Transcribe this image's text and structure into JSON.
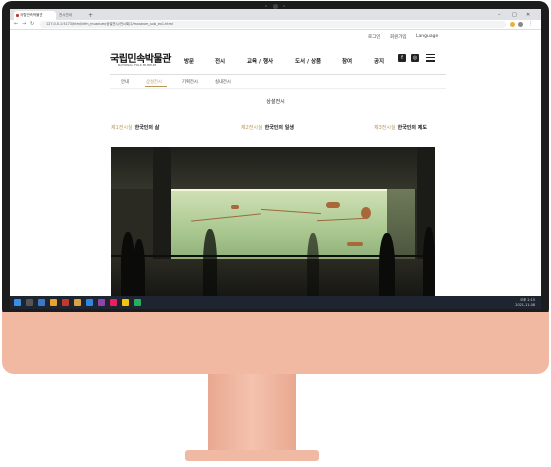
{
  "browser": {
    "tabs": [
      {
        "label": "국립민속박물관"
      },
      {
        "label": "전시안내"
      }
    ],
    "new_tab": "+",
    "url": "127.0.0.1:5173/html/nfm_museum/상설전시/전시회/2/museum_sub_ex1.html",
    "window_controls": [
      "–",
      "□",
      "✕"
    ]
  },
  "site": {
    "utility_links": [
      "로그인",
      "회원가입",
      "Language"
    ],
    "logo_text": "국립민속박물관",
    "logo_sub": "NATIONAL FOLK MUSEUM",
    "gnb": [
      "방문",
      "전시",
      "교육 / 행사",
      "도서 / 상품",
      "참여",
      "공지"
    ],
    "sns": {
      "facebook": "f",
      "instagram": "◎"
    },
    "lnb": [
      "안내",
      "상설전시",
      "기획전시",
      "실내전시"
    ],
    "lnb_active_index": 1,
    "page_title": "상설전시",
    "halls": [
      {
        "num": "제1전시실",
        "name": "한국인의 삶"
      },
      {
        "num": "제2전시실",
        "name": "한국인의 일생"
      },
      {
        "num": "제3전시실",
        "name": "한국인의 제도"
      }
    ]
  },
  "taskbar": {
    "time": "오후 2:15",
    "date": "2021-11-08"
  },
  "colors": {
    "accent": "#b8975b",
    "bezel": "#1c1c1c",
    "chin": "#f1b9a2"
  }
}
